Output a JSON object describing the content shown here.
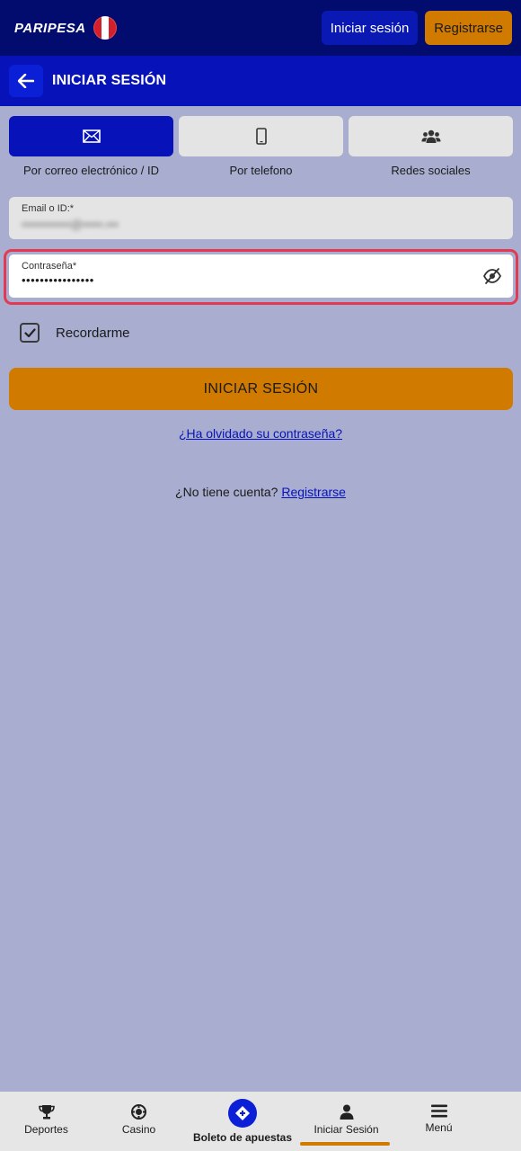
{
  "header": {
    "logo_text": "PARIPESA",
    "login_label": "Iniciar sesión",
    "register_label": "Registrarse"
  },
  "titlebar": {
    "title": "INICIAR SESIÓN"
  },
  "tabs": [
    {
      "label": "Por correo electrónico / ID",
      "icon": "envelope-icon",
      "active": true
    },
    {
      "label": "Por telefono",
      "icon": "mobile-phone-icon",
      "active": false
    },
    {
      "label": "Redes sociales",
      "icon": "users-group-icon",
      "active": false
    }
  ],
  "form": {
    "email_label": "Email o ID:*",
    "email_value": "••••••••••••@•••••.•••",
    "password_label": "Contraseña*",
    "password_value": "••••••••••••••••",
    "remember_label": "Recordarme",
    "submit_label": "INICIAR SESIÓN",
    "forgot_label": "¿Ha olvidado su contraseña?",
    "no_account_text": "¿No tiene cuenta?",
    "register_link": "Registrarse"
  },
  "bottom_nav": [
    {
      "label": "Deportes",
      "icon": "trophy-icon"
    },
    {
      "label": "Casino",
      "icon": "casino-chip-icon"
    },
    {
      "label": "Boleto de apuestas",
      "icon": "bet-slip-icon"
    },
    {
      "label": "Iniciar Sesión",
      "icon": "user-icon",
      "active": true
    },
    {
      "label": "Menú",
      "icon": "hamburger-menu-icon"
    }
  ],
  "colors": {
    "header_bg": "#020c6e",
    "accent_blue": "#0712b8",
    "accent_orange": "#d07a00",
    "page_bg": "#a9aed0",
    "focus_outline": "#e23a52"
  }
}
